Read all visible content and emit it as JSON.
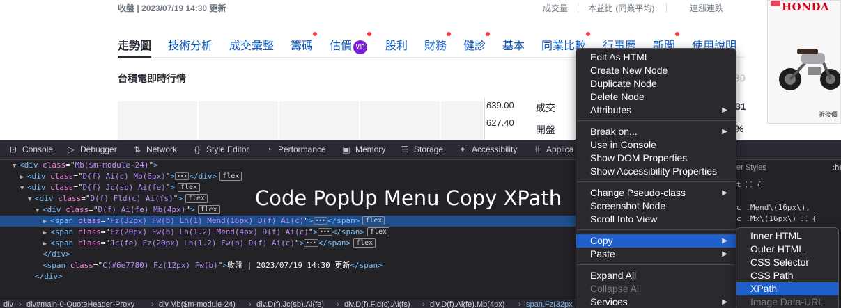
{
  "web": {
    "status_line": "收盤 | 2023/07/19 14:30 更新",
    "stat_headers": [
      "成交量",
      "本益比 (同業平均)",
      "連漲連跌"
    ],
    "ad": {
      "brand": "HONDA",
      "caption": "折後價"
    },
    "tabs": [
      {
        "label": "走勢圖",
        "active": true,
        "dot": false,
        "vip": false
      },
      {
        "label": "技術分析",
        "active": false,
        "dot": false,
        "vip": false
      },
      {
        "label": "成交彙整",
        "active": false,
        "dot": false,
        "vip": false
      },
      {
        "label": "籌碼",
        "active": false,
        "dot": true,
        "vip": false
      },
      {
        "label": "估價",
        "active": false,
        "dot": true,
        "vip": true
      },
      {
        "label": "股利",
        "active": false,
        "dot": false,
        "vip": false
      },
      {
        "label": "財務",
        "active": false,
        "dot": true,
        "vip": false
      },
      {
        "label": "健診",
        "active": false,
        "dot": true,
        "vip": false
      },
      {
        "label": "基本",
        "active": false,
        "dot": false,
        "vip": false
      },
      {
        "label": "同業比較",
        "active": false,
        "dot": true,
        "vip": false
      },
      {
        "label": "行事曆",
        "active": false,
        "dot": false,
        "vip": false
      },
      {
        "label": "新聞",
        "active": false,
        "dot": true,
        "vip": false
      },
      {
        "label": "使用說明",
        "active": false,
        "dot": false,
        "vip": false
      }
    ],
    "vip_label": "VIP",
    "section_title": "台積電即時行情",
    "right_partial_num": "30",
    "prices": [
      "639.00",
      "627.40"
    ],
    "labels": [
      "成交",
      "開盤"
    ],
    "right_values": [
      "31",
      "%"
    ]
  },
  "devtools": {
    "tabs": [
      {
        "icon": "console-icon",
        "glyph": "⊡",
        "label": "Console"
      },
      {
        "icon": "debugger-icon",
        "glyph": "▷",
        "label": "Debugger"
      },
      {
        "icon": "network-icon",
        "glyph": "⇅",
        "label": "Network"
      },
      {
        "icon": "style-editor-icon",
        "glyph": "{}",
        "label": "Style Editor"
      },
      {
        "icon": "performance-icon",
        "glyph": "◔",
        "label": "Performance"
      },
      {
        "icon": "memory-icon",
        "glyph": "▣",
        "label": "Memory"
      },
      {
        "icon": "storage-icon",
        "glyph": "☰",
        "label": "Storage"
      },
      {
        "icon": "accessibility-icon",
        "glyph": "✦",
        "label": "Accessibility"
      },
      {
        "icon": "application-icon",
        "glyph": "⁞⁞",
        "label": "Applica"
      }
    ],
    "markup": [
      {
        "indent": 0,
        "tw": "▼",
        "tag": "div",
        "cls": "Mb($m-module-24)",
        "tail": ">",
        "ell": false,
        "close": "",
        "flex": false,
        "sel": false
      },
      {
        "indent": 1,
        "tw": "▶",
        "tag": "div",
        "cls": "D(f) Ai(c) Mb(6px)",
        "tail": ">",
        "ell": true,
        "close": "</div>",
        "flex": true,
        "sel": false
      },
      {
        "indent": 1,
        "tw": "▼",
        "tag": "div",
        "cls": "D(f) Jc(sb) Ai(fe)",
        "tail": ">",
        "ell": false,
        "close": "",
        "flex": true,
        "sel": false
      },
      {
        "indent": 2,
        "tw": "▼",
        "tag": "div",
        "cls": "D(f) Fld(c) Ai(fs)",
        "tail": ">",
        "ell": false,
        "close": "",
        "flex": true,
        "sel": false
      },
      {
        "indent": 3,
        "tw": "▼",
        "tag": "div",
        "cls": "D(f) Ai(fe) Mb(4px)",
        "tail": ">",
        "ell": false,
        "close": "",
        "flex": true,
        "sel": false
      },
      {
        "indent": 4,
        "tw": "▶",
        "tag": "span",
        "cls": "Fz(32px) Fw(b) Lh(1) Mend(16px) D(f) Ai(c)",
        "tail": ">",
        "ell": true,
        "close": "</span>",
        "flex": true,
        "sel": true
      },
      {
        "indent": 4,
        "tw": "▶",
        "tag": "span",
        "cls": "Fz(20px) Fw(b) Lh(1.2) Mend(4px) D(f) Ai(c)",
        "tail": ">",
        "ell": true,
        "close": "</span>",
        "flex": true,
        "sel": false
      },
      {
        "indent": 4,
        "tw": "▶",
        "tag": "span",
        "cls": "Jc(fe) Fz(20px) Lh(1.2) Fw(b) D(f) Ai(c)",
        "tail": ">",
        "ell": true,
        "close": "</span>",
        "flex": true,
        "sel": false
      },
      {
        "indent": 3,
        "tw": "",
        "tag": "",
        "cls": "",
        "tail": "",
        "ell": false,
        "close": "</div>",
        "flex": false,
        "sel": false
      },
      {
        "indent": 3,
        "tw": "",
        "tag": "span",
        "cls": "C(#6e7780) Fz(12px) Fw(b)",
        "tail": ">",
        "text": "收盤 | 2023/07/19 14:30 更新",
        "ell": false,
        "close": "</span>",
        "flex": false,
        "sel": false
      },
      {
        "indent": 2,
        "tw": "",
        "tag": "",
        "cls": "",
        "tail": "",
        "ell": false,
        "close": "</div>",
        "flex": false,
        "sel": false
      }
    ],
    "styles_header": "er Styles",
    "styles_header_right": ":he",
    "styles_lines": [
      "t ⸬ {",
      "",
      "c .Mend\\(16px\\),",
      "c .Mx\\(16px\\) ⸬ {"
    ],
    "breadcrumb": [
      "div",
      "div#main-0-QuoteHeader-Proxy",
      "div.Mb($m-module-24)",
      "div.D(f).Jc(sb).Ai(fe)",
      "div.D(f).Fld(c).Ai(fs)",
      "div.D(f).Ai(fe).Mb(4px)",
      "span.Fz(32px"
    ]
  },
  "caption": "Code PopUp Menu Copy XPath",
  "context_menu": {
    "groups": [
      [
        {
          "label": "Edit As HTML",
          "submenu": false,
          "disabled": false,
          "highlighted": false
        },
        {
          "label": "Create New Node",
          "submenu": false,
          "disabled": false,
          "highlighted": false
        },
        {
          "label": "Duplicate Node",
          "submenu": false,
          "disabled": false,
          "highlighted": false
        },
        {
          "label": "Delete Node",
          "submenu": false,
          "disabled": false,
          "highlighted": false
        },
        {
          "label": "Attributes",
          "submenu": true,
          "disabled": false,
          "highlighted": false
        }
      ],
      [
        {
          "label": "Break on...",
          "submenu": true,
          "disabled": false,
          "highlighted": false
        },
        {
          "label": "Use in Console",
          "submenu": false,
          "disabled": false,
          "highlighted": false
        },
        {
          "label": "Show DOM Properties",
          "submenu": false,
          "disabled": false,
          "highlighted": false
        },
        {
          "label": "Show Accessibility Properties",
          "submenu": false,
          "disabled": false,
          "highlighted": false
        }
      ],
      [
        {
          "label": "Change Pseudo-class",
          "submenu": true,
          "disabled": false,
          "highlighted": false
        },
        {
          "label": "Screenshot Node",
          "submenu": false,
          "disabled": false,
          "highlighted": false
        },
        {
          "label": "Scroll Into View",
          "submenu": false,
          "disabled": false,
          "highlighted": false
        }
      ],
      [
        {
          "label": "Copy",
          "submenu": true,
          "disabled": false,
          "highlighted": true
        },
        {
          "label": "Paste",
          "submenu": true,
          "disabled": false,
          "highlighted": false
        }
      ],
      [
        {
          "label": "Expand All",
          "submenu": false,
          "disabled": false,
          "highlighted": false
        },
        {
          "label": "Collapse All",
          "submenu": false,
          "disabled": true,
          "highlighted": false
        },
        {
          "label": "Services",
          "submenu": true,
          "disabled": false,
          "highlighted": false
        }
      ]
    ]
  },
  "copy_submenu": {
    "items": [
      {
        "label": "Inner HTML",
        "disabled": false,
        "highlighted": false
      },
      {
        "label": "Outer HTML",
        "disabled": false,
        "highlighted": false
      },
      {
        "label": "CSS Selector",
        "disabled": false,
        "highlighted": false
      },
      {
        "label": "CSS Path",
        "disabled": false,
        "highlighted": false
      },
      {
        "label": "XPath",
        "disabled": false,
        "highlighted": true
      },
      {
        "label": "Image Data-URL",
        "disabled": true,
        "highlighted": false
      }
    ]
  },
  "colors": {
    "link_blue": "#0f5cc2",
    "selection": "#204e8a",
    "menu_highlight": "#1f5fcc",
    "notify_dot": "#ff333a",
    "vip_purple": "#7b1fd9"
  }
}
